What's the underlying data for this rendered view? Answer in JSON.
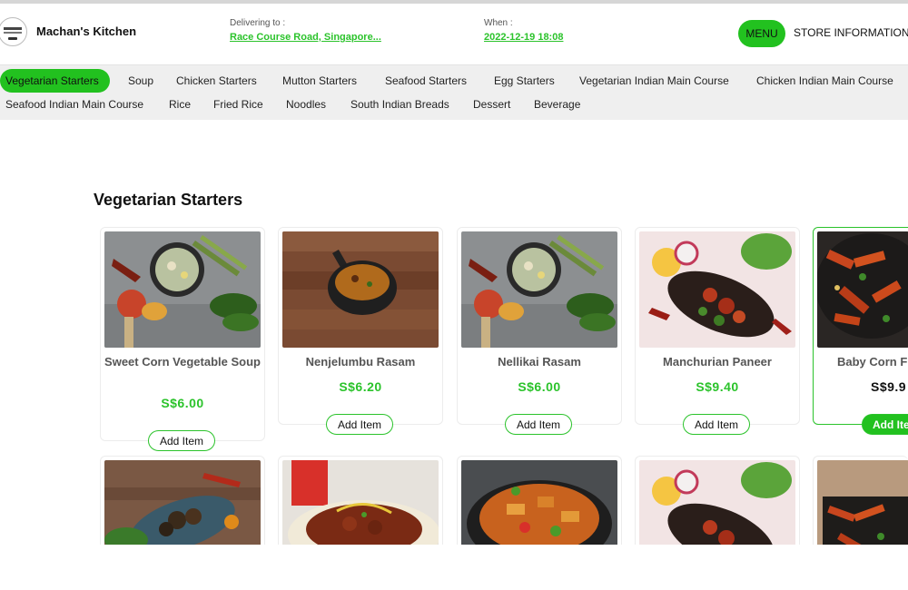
{
  "header": {
    "brand": "Machan's Kitchen",
    "delivering_label": "Delivering to :",
    "delivering_value": "Race Course Road, Singapore...",
    "when_label": "When :",
    "when_value": "2022-12-19 18:08",
    "menu_label": "MENU",
    "store_info_label": "STORE INFORMATION"
  },
  "categories": [
    "Vegetarian Starters",
    "Soup",
    "Chicken Starters",
    "Mutton Starters",
    "Seafood Starters",
    "Egg Starters",
    "Vegetarian Indian Main Course",
    "Chicken Indian Main Course",
    "Seafood Indian Main Course",
    "Rice",
    "Fried Rice",
    "Noodles",
    "South Indian Breads",
    "Dessert",
    "Beverage"
  ],
  "active_category": "Vegetarian Starters",
  "section": {
    "title": "Vegetarian Starters"
  },
  "items": [
    {
      "name": "Sweet Corn Vegetable Soup",
      "price": "S$6.00",
      "add_label": "Add Item"
    },
    {
      "name": "Nenjelumbu Rasam",
      "price": "S$6.20",
      "add_label": "Add Item"
    },
    {
      "name": "Nellikai Rasam",
      "price": "S$6.00",
      "add_label": "Add Item"
    },
    {
      "name": "Manchurian Paneer",
      "price": "S$9.40",
      "add_label": "Add Item"
    },
    {
      "name": "Baby Corn F",
      "price": "S$9.9",
      "add_label": "Add Ite"
    }
  ],
  "colors": {
    "accent": "#22c11f",
    "link": "#2bc32b",
    "nav_bg": "#efefef"
  }
}
